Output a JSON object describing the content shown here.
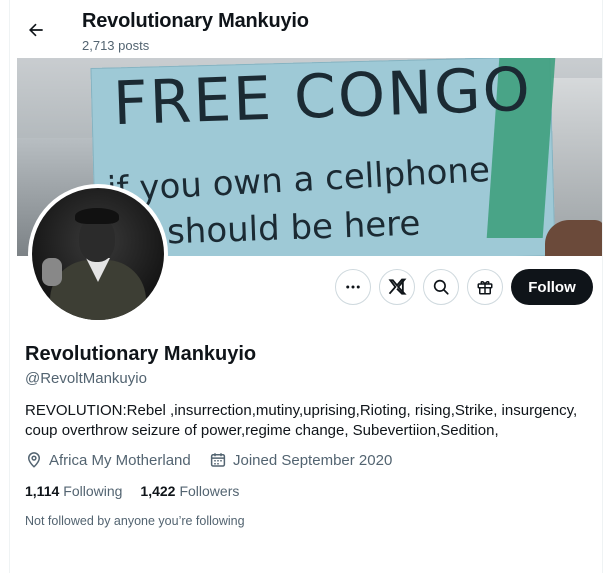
{
  "header": {
    "back_icon": "arrow-left-icon",
    "name": "Revolutionary Mankuyio",
    "posts": "2,713 posts"
  },
  "banner": {
    "line1": "FREE CONGO",
    "line2": "if you own a cellphone",
    "line3": "should be here"
  },
  "actions": {
    "more_icon": "more-icon",
    "grok_icon": "grok-icon",
    "search_icon": "search-icon",
    "gift_icon": "gift-icon",
    "follow_label": "Follow"
  },
  "profile": {
    "name": "Revolutionary Mankuyio",
    "handle": "@RevoltMankuyio",
    "bio": "REVOLUTION:Rebel ,insurrection,mutiny,uprising,Rioting, rising,Strike, insurgency, coup overthrow seizure of power,regime change, Subevertiion,Sedition,",
    "location": "Africa My Motherland",
    "joined": "Joined September 2020",
    "following_count": "1,114",
    "following_label": "Following",
    "followers_count": "1,422",
    "followers_label": "Followers",
    "not_followed": "Not followed by anyone you’re following"
  },
  "colors": {
    "text": "#0f1419",
    "secondary": "#536471",
    "border": "#cfd9de",
    "follow_bg": "#0f1419"
  }
}
